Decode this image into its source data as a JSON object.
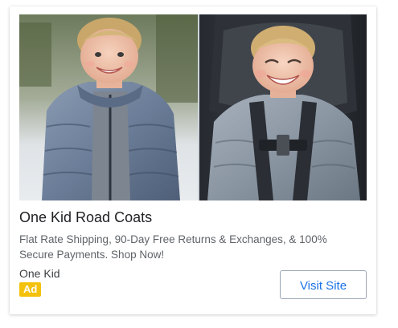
{
  "ad": {
    "title": "One Kid Road Coats",
    "description": "Flat Rate Shipping, 90-Day Free Returns & Exchanges, & 100% Secure Payments. Shop Now!",
    "advertiser": "One Kid",
    "badge": "Ad",
    "cta_label": "Visit Site",
    "images": [
      {
        "subject": "toddler-in-grey-puffer-coat-outdoors"
      },
      {
        "subject": "toddler-in-grey-coat-in-car-seat"
      }
    ]
  },
  "colors": {
    "badge_background": "#f4c20d",
    "cta_text": "#1a73e8",
    "title_text": "#202124",
    "description_text": "#5f6368"
  }
}
